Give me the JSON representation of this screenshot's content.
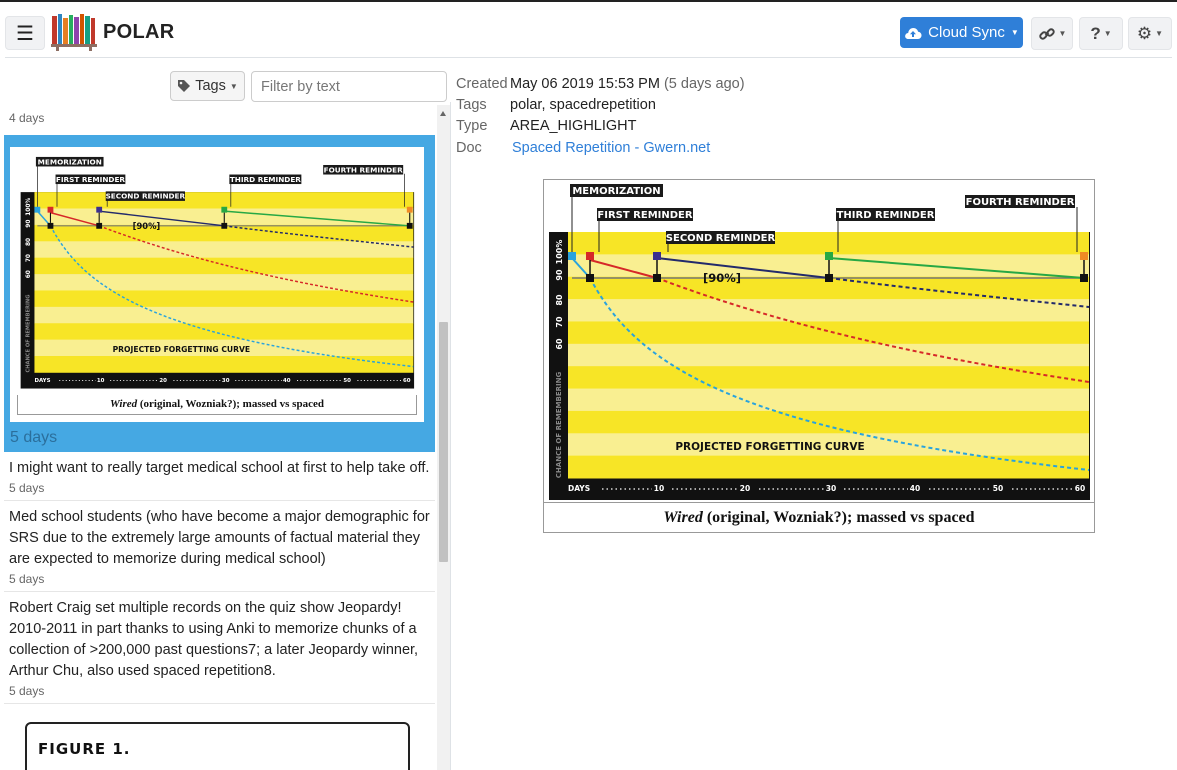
{
  "app": {
    "brand": "POLAR"
  },
  "navbar": {
    "menu_icon": "hamburger-icon",
    "logo_icon": "bookshelf-icon",
    "sync_label": "Cloud Sync",
    "sync_icon": "cloud-upload-icon",
    "link_icon": "link-icon",
    "help_icon": "question-icon",
    "settings_icon": "gear-icon"
  },
  "toolbar": {
    "tags_label": "Tags",
    "tags_icon": "tag-icon",
    "filter_placeholder": "Filter by text"
  },
  "list": {
    "top_meta": "4 days",
    "selected": {
      "meta": "5 days",
      "caption_em": "Wired",
      "caption_rest": " (original, Wozniak?); massed vs spaced"
    },
    "items": [
      {
        "text": "I might want to really target medical school at first to help take off.",
        "meta": "5 days"
      },
      {
        "text": "Med school students (who have become a major demographic for SRS due to the extremely large amounts of factual material they are expected to memorize during medical school)",
        "meta": "5 days"
      },
      {
        "text": "Robert Craig set multiple records on the quiz show Jeopardy! 2010-2011 in part thanks to using Anki to memorize chunks of a collection of >200,000 past questions7; a later Jeopardy winner, Arthur Chu, also used spaced repetition8.",
        "meta": "5 days"
      }
    ],
    "figure_title": "FIGURE 1."
  },
  "details": {
    "created_label": "Created",
    "created_value": "May 06 2019 15:53 PM",
    "created_relative": "(5 days ago)",
    "tags_label": "Tags",
    "tags_value": "polar, spacedrepetition",
    "type_label": "Type",
    "type_value": "AREA_HIGHLIGHT",
    "doc_label": "Doc",
    "doc_value": "Spaced Repetition - Gwern.net"
  },
  "figure": {
    "labels": {
      "memorization": "MEMORIZATION",
      "first": "FIRST REMINDER",
      "second": "SECOND REMINDER",
      "third": "THIRD REMINDER",
      "fourth": "FOURTH REMINDER",
      "ninety": "[90%]",
      "curve": "PROJECTED FORGETTING CURVE",
      "yaxis": "CHANCE OF REMEMBERING",
      "days": "DAYS",
      "yticks": [
        "100%",
        "90",
        "80",
        "70",
        "60"
      ],
      "xticks": [
        "10",
        "20",
        "30",
        "40",
        "50",
        "60"
      ]
    },
    "caption_em": "Wired",
    "caption_rest": " (original, Wozniak?); massed vs spaced"
  }
}
